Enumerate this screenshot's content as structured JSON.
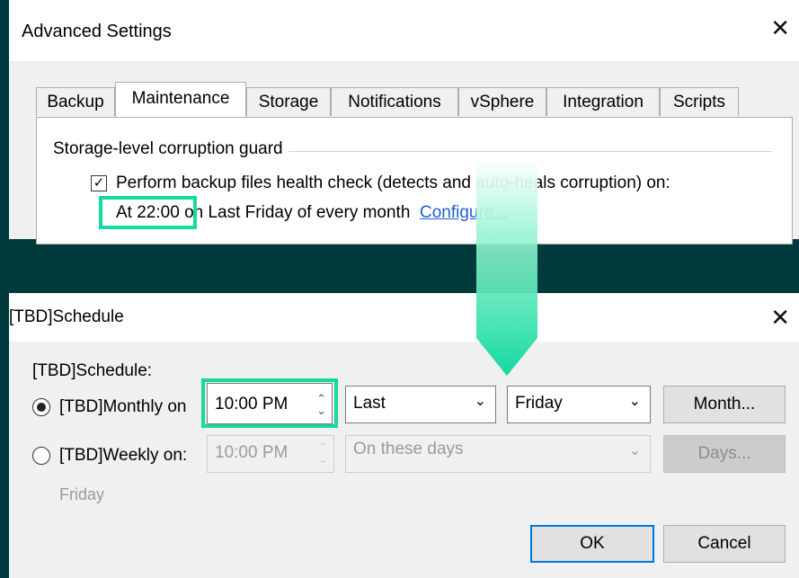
{
  "advanced": {
    "title": "Advanced Settings",
    "close": "✕",
    "tabs": [
      "Backup",
      "Maintenance",
      "Storage",
      "Notifications",
      "vSphere",
      "Integration",
      "Scripts"
    ],
    "active_tab": "Maintenance",
    "group_label": "Storage-level corruption guard",
    "checkbox_checked": true,
    "checkbox_mark": "✓",
    "checkbox_label": "Perform backup files health check (detects and auto-heals corruption) on:",
    "schedule_time": "At 22:00",
    "schedule_rest": "on Last Friday of every month",
    "configure_link": "Configure..."
  },
  "schedule": {
    "title": "[TBD]Schedule",
    "close": "✕",
    "section_label": "[TBD]Schedule:",
    "monthly_label": "[TBD]Monthly on",
    "monthly_time": "10:00 PM",
    "monthly_selected": true,
    "week_select": "Last",
    "day_select": "Friday",
    "month_button": "Month...",
    "weekly_label": "[TBD]Weekly on:",
    "weekly_time": "10:00 PM",
    "weekly_days_select": "On these days",
    "days_button": "Days...",
    "weekly_hint": "Friday",
    "ok_button": "OK",
    "cancel_button": "Cancel"
  },
  "colors": {
    "highlight": "#14d9a0",
    "background": "#003a3c",
    "link": "#1c5fcf"
  }
}
